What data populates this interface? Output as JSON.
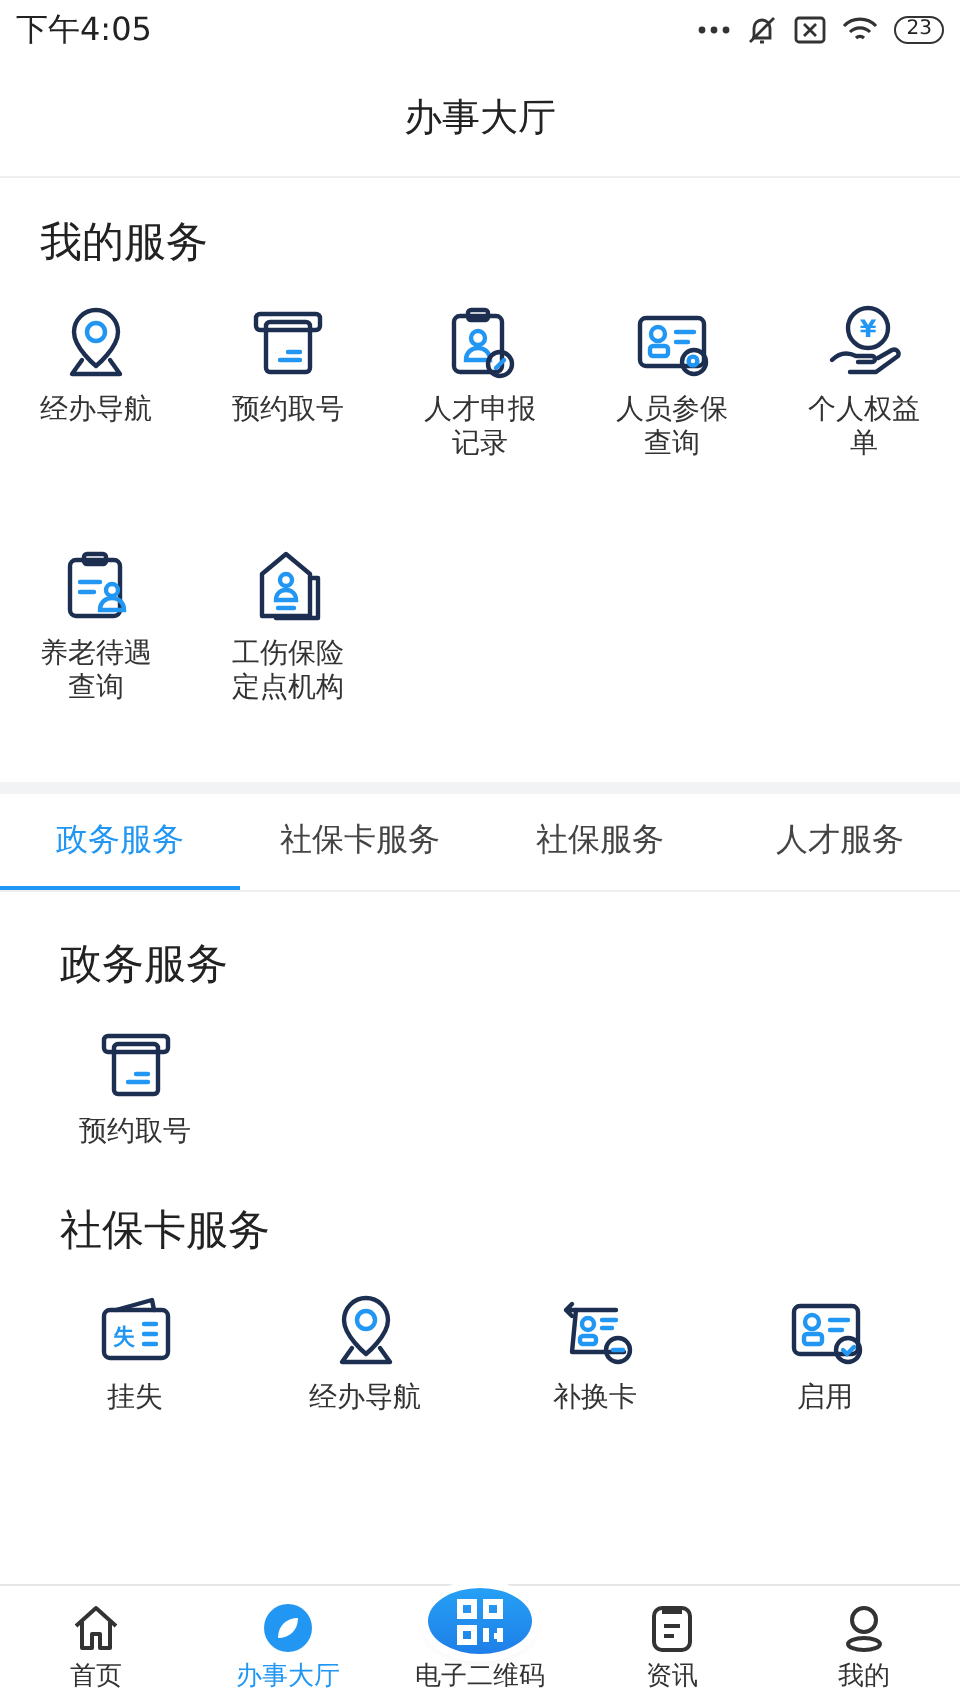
{
  "status_bar": {
    "time": "下午4:05",
    "battery": "23"
  },
  "header": {
    "title": "办事大厅"
  },
  "my_services": {
    "title": "我的服务",
    "items": [
      {
        "label": "经办导航"
      },
      {
        "label": "预约取号"
      },
      {
        "label": "人才申报记录"
      },
      {
        "label": "人员参保查询"
      },
      {
        "label": "个人权益单",
        "icon_text": "¥"
      },
      {
        "label": "养老待遇查询"
      },
      {
        "label": "工伤保险定点机构"
      }
    ]
  },
  "tabs": [
    {
      "label": "政务服务",
      "selected": true
    },
    {
      "label": "社保卡服务",
      "selected": false
    },
    {
      "label": "社保服务",
      "selected": false
    },
    {
      "label": "人才服务",
      "selected": false
    }
  ],
  "sections": [
    {
      "title": "政务服务",
      "items": [
        {
          "label": "预约取号"
        }
      ]
    },
    {
      "title": "社保卡服务",
      "items": [
        {
          "label": "挂失",
          "icon_text": "失"
        },
        {
          "label": "经办导航"
        },
        {
          "label": "补换卡"
        },
        {
          "label": "启用"
        }
      ]
    }
  ],
  "bottom_nav": [
    {
      "label": "首页",
      "selected": false,
      "kind": "tab"
    },
    {
      "label": "办事大厅",
      "selected": true,
      "kind": "tab"
    },
    {
      "label": "电子二维码",
      "selected": false,
      "kind": "raised"
    },
    {
      "label": "资讯",
      "selected": false,
      "kind": "tab"
    },
    {
      "label": "我的",
      "selected": false,
      "kind": "tab"
    }
  ]
}
